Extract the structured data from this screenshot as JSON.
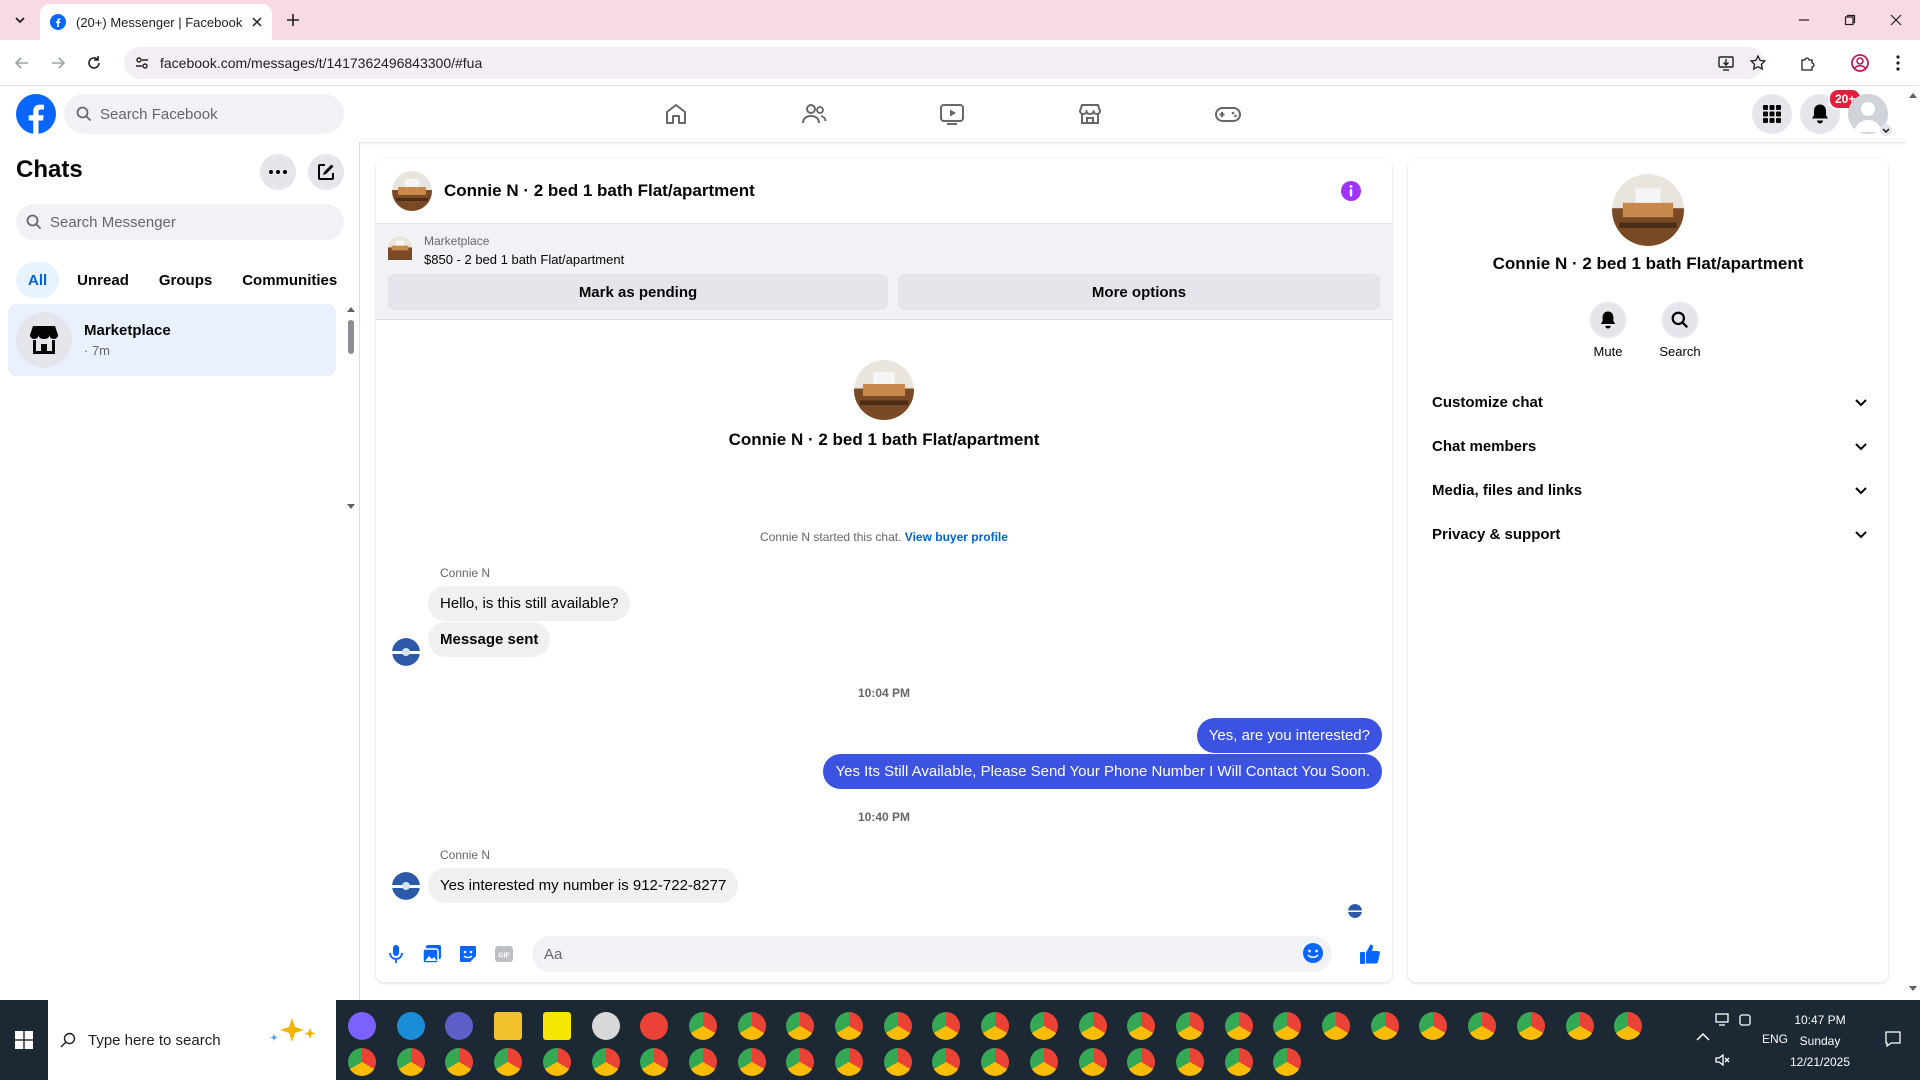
{
  "browser": {
    "tab_title": "(20+) Messenger | Facebook",
    "url": "facebook.com/messages/t/1417362496843300/#fua"
  },
  "fb_header": {
    "search_placeholder": "Search Facebook",
    "notification_badge": "20+"
  },
  "left_panel": {
    "title": "Chats",
    "search_placeholder": "Search Messenger",
    "tabs": [
      {
        "label": "All",
        "active": true
      },
      {
        "label": "Unread",
        "active": false
      },
      {
        "label": "Groups",
        "active": false
      },
      {
        "label": "Communities",
        "active": false
      }
    ],
    "chats": [
      {
        "name": "Marketplace",
        "time": "· 7m"
      }
    ]
  },
  "conversation": {
    "title": "Connie N · 2 bed 1 bath Flat/apartment",
    "marketplace_label": "Marketplace",
    "listing_desc": "$850 - 2 bed 1 bath Flat/apartment",
    "mark_pending_label": "Mark as pending",
    "more_options_label": "More options",
    "intro_name": "Connie N · 2 bed 1 bath Flat/apartment",
    "started_text": "Connie N started this chat.",
    "view_buyer_link": "View buyer profile",
    "messages": [
      {
        "sender": "Connie N",
        "text": "Hello, is this still available?"
      },
      {
        "text": "Message sent"
      },
      {
        "timestamp": "10:04 PM"
      },
      {
        "text": "Yes, are you interested?"
      },
      {
        "text": "Yes Its Still Available, Please Send Your Phone Number I Will Contact You Soon."
      },
      {
        "timestamp": "10:40 PM"
      },
      {
        "sender": "Connie N",
        "text": "Yes interested my number is 912-722-8277"
      }
    ],
    "composer_placeholder": "Aa"
  },
  "right_panel": {
    "name": "Connie N · 2 bed 1 bath Flat/apartment",
    "mute_label": "Mute",
    "search_label": "Search",
    "sections": [
      "Customize chat",
      "Chat members",
      "Media, files and links",
      "Privacy & support"
    ]
  },
  "taskbar": {
    "search_placeholder": "Type here to search",
    "time": "10:47 PM",
    "day": "Sunday",
    "date": "12/21/2025",
    "language": "ENG"
  },
  "colors": {
    "facebook_blue": "#0866ff",
    "outgoing_bubble": "#3b53e0",
    "tab_strip": "#f9d9e4",
    "taskbar": "#1c2833",
    "info_purple": "#a033ff"
  }
}
